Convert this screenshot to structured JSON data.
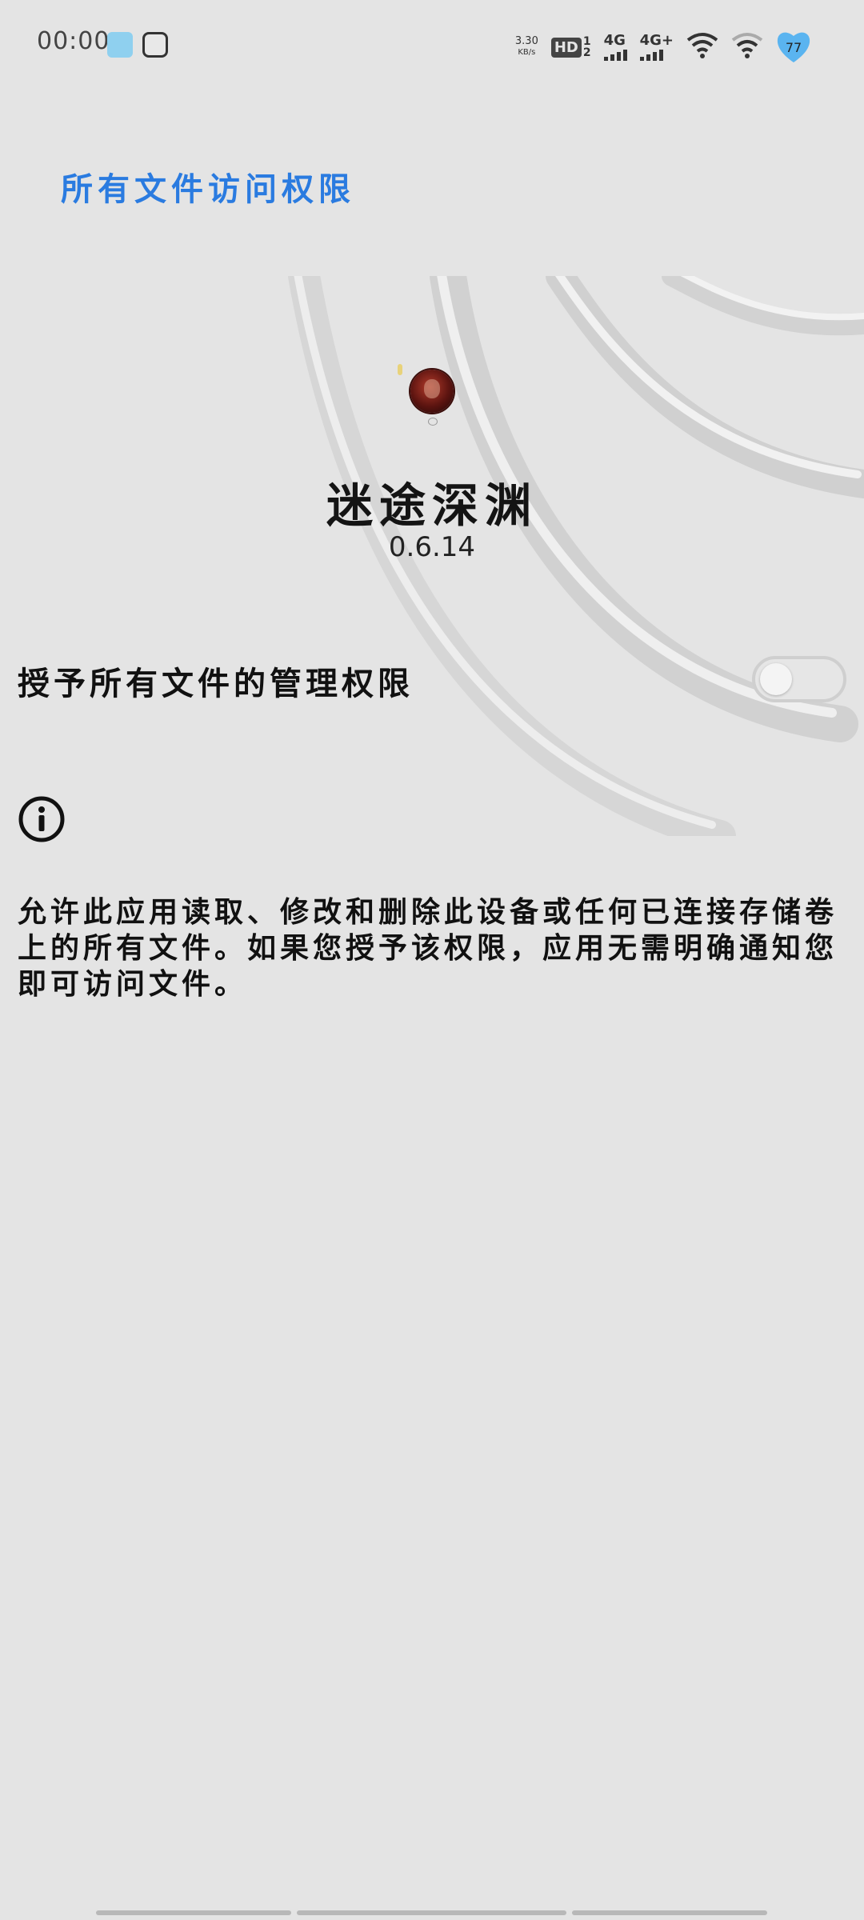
{
  "status_bar": {
    "time": "00:00",
    "net_speed_value": "3.30",
    "net_speed_unit": "KB/s",
    "hd_label": "HD",
    "sim1": "1",
    "sim2": "2",
    "network1": "4G",
    "network2": "4G+",
    "battery": "77",
    "battery_color": "#5ab4f0"
  },
  "header": {
    "title": "所有文件访问权限",
    "title_color": "#2a7be0"
  },
  "app": {
    "name": "迷途深渊",
    "version": "0.6.14"
  },
  "permission": {
    "label": "授予所有文件的管理权限",
    "enabled": false
  },
  "info": {
    "icon": "info-icon",
    "description": "允许此应用读取、修改和删除此设备或任何已连接存储卷上的所有文件。如果您授予该权限，应用无需明确通知您即可访问文件。"
  }
}
